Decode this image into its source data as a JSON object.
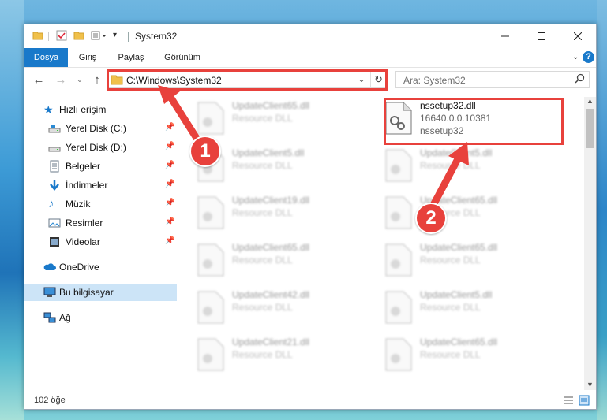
{
  "window": {
    "title": "System32",
    "controls": [
      "minimize-icon",
      "maximize-icon",
      "close-icon"
    ]
  },
  "ribbon": {
    "tabs": [
      {
        "label": "Dosya",
        "active": true
      },
      {
        "label": "Giriş",
        "active": false
      },
      {
        "label": "Paylaş",
        "active": false
      },
      {
        "label": "Görünüm",
        "active": false
      }
    ],
    "accent": "#1979ca"
  },
  "address": {
    "path": "C:\\Windows\\System32",
    "search_placeholder": "Ara: System32"
  },
  "nav": {
    "quick_access": "Hızlı erişim",
    "items": [
      {
        "label": "Yerel Disk (C:)",
        "icon": "drive-icon",
        "pinned": true
      },
      {
        "label": "Yerel Disk (D:)",
        "icon": "drive-icon",
        "pinned": true
      },
      {
        "label": "Belgeler",
        "icon": "documents-icon",
        "pinned": true
      },
      {
        "label": "İndirmeler",
        "icon": "download-icon",
        "pinned": true
      },
      {
        "label": "Müzik",
        "icon": "music-icon",
        "pinned": true
      },
      {
        "label": "Resimler",
        "icon": "pictures-icon",
        "pinned": true
      },
      {
        "label": "Videolar",
        "icon": "videos-icon",
        "pinned": true
      }
    ],
    "onedrive": "OneDrive",
    "this_pc": "Bu bilgisayar",
    "network": "Ağ"
  },
  "files": {
    "highlighted": {
      "name": "nssetup32.dll",
      "version": "16640.0.0.10381",
      "description": "nssetup32"
    },
    "left_column": [
      {
        "name": "UpdateClient65.dll",
        "type": "Resource DLL"
      },
      {
        "name": "UpdateClient5.dll",
        "type": "Resource DLL"
      },
      {
        "name": "UpdateClient19.dll",
        "type": "Resource DLL"
      },
      {
        "name": "UpdateClient65.dll",
        "type": "Resource DLL"
      },
      {
        "name": "UpdateClient42.dll",
        "type": "Resource DLL"
      },
      {
        "name": "UpdateClient21.dll",
        "type": "Resource DLL"
      }
    ],
    "right_column": [
      {
        "name": "UpdateClient5.dll",
        "type": "Resource DLL"
      },
      {
        "name": "UpdateClient65.dll",
        "type": "Resource DLL"
      },
      {
        "name": "UpdateClient65.dll",
        "type": "Resource DLL"
      },
      {
        "name": "UpdateClient5.dll",
        "type": "Resource DLL"
      },
      {
        "name": "UpdateClient65.dll",
        "type": "Resource DLL"
      }
    ]
  },
  "status": {
    "item_count": "102 öğe"
  },
  "annotations": {
    "step1": "1",
    "step2": "2",
    "color": "#e8413c"
  }
}
